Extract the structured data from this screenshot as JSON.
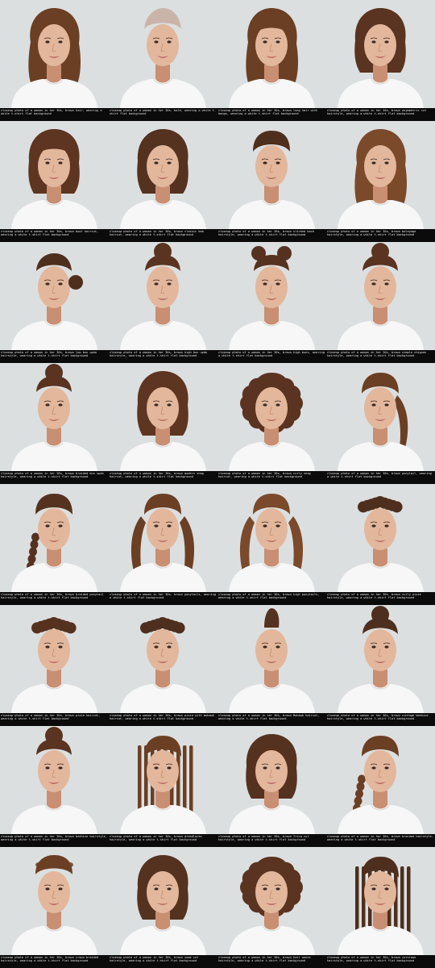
{
  "palette": {
    "background": "#dcdfe0",
    "skin": "#e3b79c",
    "skin_shade": "#c98f72",
    "tshirt": "#f7f7f7",
    "lips": "#b86a62",
    "eyes": "#3b2a22",
    "caption_bg": "#0b0b0b",
    "caption_text": "#e8e8e8"
  },
  "portraits": [
    {
      "caption": "closeup photo of a woman in her 30s, brown hair, wearing a white t-shirt flat background",
      "hair_style": "loose-waves",
      "hair_color": "#6b3f24"
    },
    {
      "caption": "closeup photo of a woman in her 30s, bald, wearing a white t-shirt flat background",
      "hair_style": "bald",
      "hair_color": "#b88a72"
    },
    {
      "caption": "closeup photo of a woman in her 30s, brown long hair with bangs, wearing a white t-shirt flat background",
      "hair_style": "long-bangs",
      "hair_color": "#6b3f24"
    },
    {
      "caption": "closeup photo of a woman in her 30s, brown asymmetric cut hairstyle, wearing a white t-shirt flat background",
      "hair_style": "asymmetric",
      "hair_color": "#5a3420"
    },
    {
      "caption": "closeup photo of a woman in her 30s, brown bowl haircut, wearing a white t-shirt flat background",
      "hair_style": "bowl",
      "hair_color": "#5e3520"
    },
    {
      "caption": "closeup photo of a woman in her 30s, brown classic bob haircut, wearing a white t-shirt flat background",
      "hair_style": "bob",
      "hair_color": "#553220"
    },
    {
      "caption": "closeup photo of a woman in her 30s, brown slicked back hairstyle, wearing a white t-shirt flat background",
      "hair_style": "slicked",
      "hair_color": "#4e2f1d"
    },
    {
      "caption": "closeup photo of a woman in her 30s, brown balayage hairstyle, wearing a white t-shirt flat background",
      "hair_style": "balayage",
      "hair_color": "#7a4a2b"
    },
    {
      "caption": "closeup photo of a woman in her 30s, brown low bun updo hairstyle, wearing a white t-shirt flat background",
      "hair_style": "low-bun",
      "hair_color": "#4e2f1d"
    },
    {
      "caption": "closeup photo of a woman in her 30s, brown high bun updo hairstyle, wearing a white t-shirt flat background",
      "hair_style": "high-bun",
      "hair_color": "#5a3420"
    },
    {
      "caption": "closeup photo of a woman in her 30s, brown high buns, wearing a white t-shirt flat background",
      "hair_style": "double-buns",
      "hair_color": "#553220"
    },
    {
      "caption": "closeup photo of a woman in her 30s, brown simple chignon hairstyle, wearing a white t-shirt flat background",
      "hair_style": "high-bun",
      "hair_color": "#5a3420"
    },
    {
      "caption": "closeup photo of a woman in her 30s, brown braided bun updo hairstyle, wearing a white t-shirt flat background",
      "hair_style": "high-bun",
      "hair_color": "#5a3420"
    },
    {
      "caption": "closeup photo of a woman in her 30s, brown modern shag haircut, wearing a white t-shirt flat background",
      "hair_style": "shag",
      "hair_color": "#5e3520"
    },
    {
      "caption": "closeup photo of a woman in her 30s, brown curly shag haircut, wearing a white t-shirt flat background",
      "hair_style": "curly",
      "hair_color": "#5a3420"
    },
    {
      "caption": "closeup photo of a woman in her 30s, brown ponytail, wearing a white t-shirt flat background",
      "hair_style": "ponytail",
      "hair_color": "#6b3f24"
    },
    {
      "caption": "closeup photo of a woman in her 30s, brown braided ponytail hairstyle, wearing a white t-shirt flat background",
      "hair_style": "braid",
      "hair_color": "#553220"
    },
    {
      "caption": "closeup photo of a woman in her 30s, brown ponytails, wearing a white t-shirt flat background",
      "hair_style": "pigtails",
      "hair_color": "#6b3f24"
    },
    {
      "caption": "closeup photo of a woman in her 30s, brown high ponytails, wearing a white t-shirt flat background",
      "hair_style": "pigtails",
      "hair_color": "#7a4a2b"
    },
    {
      "caption": "closeup photo of a woman in her 30s, brown curly pixie hairstyle, wearing a white t-shirt flat background",
      "hair_style": "curly-pixie",
      "hair_color": "#4e2f1d"
    },
    {
      "caption": "closeup photo of a woman in her 30s, brown pixie haircut, wearing a white t-shirt flat background",
      "hair_style": "pixie",
      "hair_color": "#553220"
    },
    {
      "caption": "closeup photo of a woman in her 30s, brown pixie with mohawk haircut, wearing a white t-shirt flat background",
      "hair_style": "pixie",
      "hair_color": "#4e2f1d"
    },
    {
      "caption": "closeup photo of a woman in her 30s, brown Mohawk haircut, wearing a white t-shirt flat background",
      "hair_style": "mohawk",
      "hair_color": "#553220"
    },
    {
      "caption": "closeup photo of a woman in her 30s, brown vintage beehive hairstyle, wearing a white t-shirt flat background",
      "hair_style": "high-bun",
      "hair_color": "#4e2f1d"
    },
    {
      "caption": "closeup photo of a woman in her 30s, brown beehive hairstyle, wearing a white t-shirt flat background",
      "hair_style": "high-bun",
      "hair_color": "#5a3420"
    },
    {
      "caption": "closeup photo of a woman in her 30s, brown dreadlocks hairstyle, wearing a white t-shirt flat background",
      "hair_style": "dreadlocks",
      "hair_color": "#6b3f24"
    },
    {
      "caption": "closeup photo of a woman in her 30s, brown Trica cut hairstyle, wearing a white t-shirt flat background",
      "hair_style": "asymmetric",
      "hair_color": "#553220"
    },
    {
      "caption": "closeup photo of a woman in her 30s, brown braided hairstyle, wearing a white t-shirt flat background",
      "hair_style": "braid",
      "hair_color": "#6b3f24"
    },
    {
      "caption": "closeup photo of a woman in her 30s, brown crown braided hairstyle, wearing a white t-shirt flat background",
      "hair_style": "crown-braid",
      "hair_color": "#6b3f24"
    },
    {
      "caption": "closeup photo of a woman in her 30s, brown some cut hairstyle, wearing a white t-shirt flat background",
      "hair_style": "shag",
      "hair_color": "#553220"
    },
    {
      "caption": "closeup photo of a woman in her 30s, brown hair waves hairstyle, wearing a white t-shirt flat background",
      "hair_style": "curly",
      "hair_color": "#5a3420"
    },
    {
      "caption": "closeup photo of a woman in her 30s, brown cornrows hairstyle, wearing a white t-shirt flat background",
      "hair_style": "box-braids",
      "hair_color": "#4e2f1d"
    }
  ]
}
